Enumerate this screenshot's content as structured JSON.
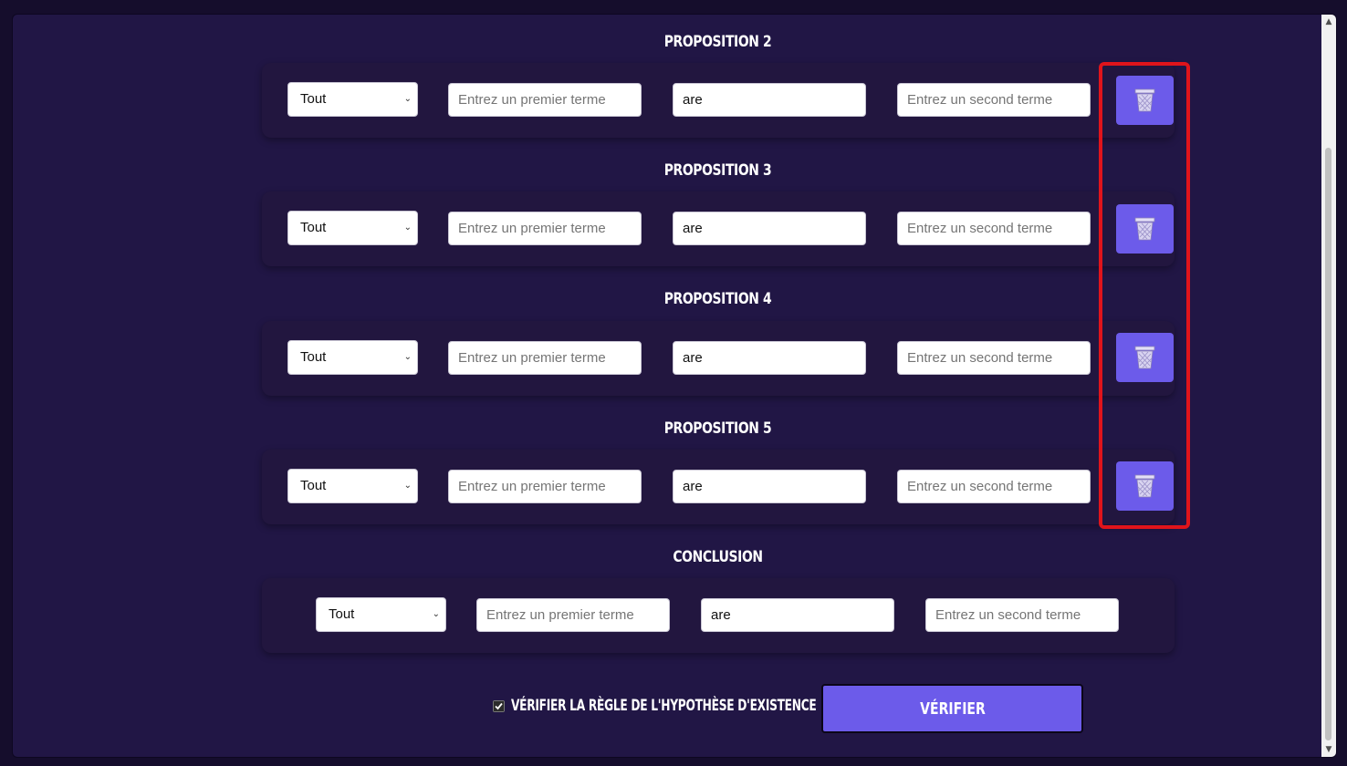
{
  "propositions": [
    {
      "title": "Proposition 2",
      "quantifier": "Tout",
      "term1_placeholder": "Entrez un premier terme",
      "copula": "are",
      "term2_placeholder": "Entrez un second terme",
      "delete_icon": "trash-icon"
    },
    {
      "title": "Proposition 3",
      "quantifier": "Tout",
      "term1_placeholder": "Entrez un premier terme",
      "copula": "are",
      "term2_placeholder": "Entrez un second terme",
      "delete_icon": "trash-icon"
    },
    {
      "title": "Proposition 4",
      "quantifier": "Tout",
      "term1_placeholder": "Entrez un premier terme",
      "copula": "are",
      "term2_placeholder": "Entrez un second terme",
      "delete_icon": "trash-icon"
    },
    {
      "title": "Proposition 5",
      "quantifier": "Tout",
      "term1_placeholder": "Entrez un premier terme",
      "copula": "are",
      "term2_placeholder": "Entrez un second terme",
      "delete_icon": "trash-icon"
    }
  ],
  "conclusion": {
    "title": "Conclusion",
    "quantifier": "Tout",
    "term1_placeholder": "Entrez un premier terme",
    "copula": "are",
    "term2_placeholder": "Entrez un second terme"
  },
  "footer": {
    "checkbox_label": "Vérifier la règle de l'hypothèse d'existence",
    "checkbox_checked": true,
    "verify_label": "Vérifier"
  },
  "colors": {
    "background": "#211645",
    "accent": "#6c5bea",
    "highlight": "#e0141b"
  }
}
